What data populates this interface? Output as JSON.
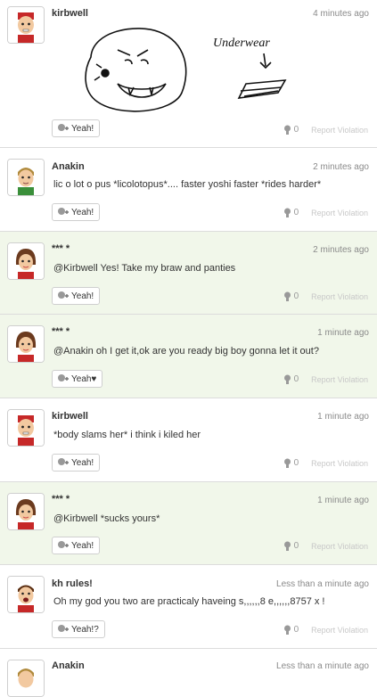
{
  "posts": [
    {
      "name": "kirbwell",
      "time": "4 minutes ago",
      "body": "",
      "yeah": "Yeah!",
      "count": "0",
      "report": "Report Violation",
      "drawing_text": "Underwear"
    },
    {
      "name": "Anakin",
      "time": "2 minutes ago",
      "body": "lic o lot o pus *licolotopus*.... faster yoshi faster *rides harder*",
      "yeah": "Yeah!",
      "count": "0",
      "report": "Report Violation"
    },
    {
      "name": "*** *",
      "time": "2 minutes ago",
      "body": "@Kirbwell Yes! Take my braw and panties",
      "yeah": "Yeah!",
      "count": "0",
      "report": "Report Violation"
    },
    {
      "name": "*** *",
      "time": "1 minute ago",
      "body": "@Anakin oh I get it,ok are you ready big boy gonna let it out?",
      "yeah": "Yeah♥",
      "count": "0",
      "report": "Report Violation"
    },
    {
      "name": "kirbwell",
      "time": "1 minute ago",
      "body": "*body slams her* i think i kiled her",
      "yeah": "Yeah!",
      "count": "0",
      "report": "Report Violation"
    },
    {
      "name": "*** *",
      "time": "1 minute ago",
      "body": "@Kirbwell *sucks yours*",
      "yeah": "Yeah!",
      "count": "0",
      "report": "Report Violation"
    },
    {
      "name": "kh rules!",
      "time": "Less than a minute ago",
      "body": "Oh my god you two are practicaly haveing s,,,,,,8 e,,,,,,8757 x !",
      "yeah": "Yeah!?",
      "count": "0",
      "report": "Report Violation"
    },
    {
      "name": "Anakin",
      "time": "Less than a minute ago",
      "body": "",
      "yeah": "",
      "count": "",
      "report": ""
    }
  ],
  "icons": {
    "yeah": "yeah-plus-icon",
    "count": "yeah-count-icon"
  },
  "colors": {
    "highlight_bg": "#f1f7ea",
    "border": "#dcdcdc",
    "muted": "#8a8a8a"
  }
}
